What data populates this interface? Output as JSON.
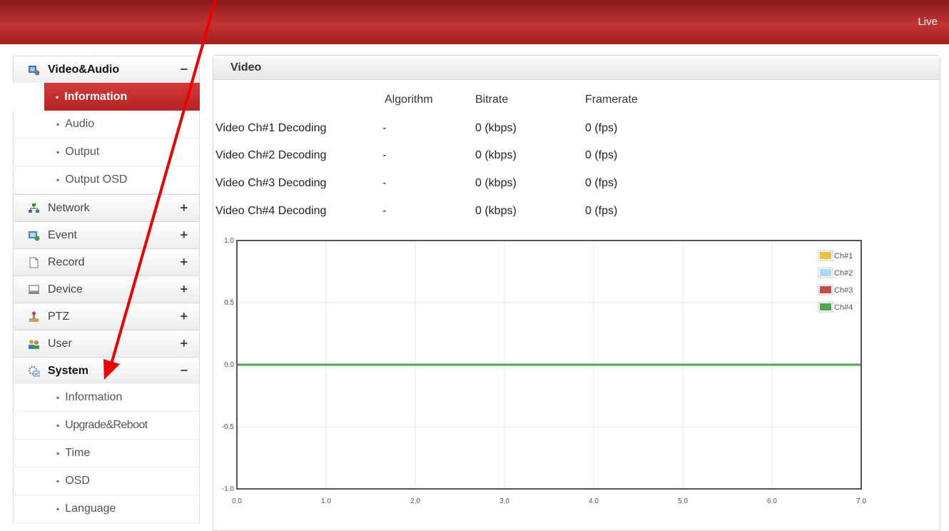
{
  "header": {
    "live_label": "Live"
  },
  "sidebar": {
    "groups": [
      {
        "label": "Video&Audio",
        "toggle": "−",
        "icon": "video-audio-icon",
        "items": [
          {
            "label": "Information"
          },
          {
            "label": "Audio"
          },
          {
            "label": "Output"
          },
          {
            "label": "Output OSD"
          }
        ]
      },
      {
        "label": "Network",
        "toggle": "+",
        "icon": "network-icon"
      },
      {
        "label": "Event",
        "toggle": "+",
        "icon": "event-icon"
      },
      {
        "label": "Record",
        "toggle": "+",
        "icon": "record-icon"
      },
      {
        "label": "Device",
        "toggle": "+",
        "icon": "device-icon"
      },
      {
        "label": "PTZ",
        "toggle": "+",
        "icon": "ptz-icon"
      },
      {
        "label": "User",
        "toggle": "+",
        "icon": "user-icon"
      },
      {
        "label": "System",
        "toggle": "−",
        "icon": "system-icon",
        "items": [
          {
            "label": "Information"
          },
          {
            "label": "Upgrade&Reboot"
          },
          {
            "label": "Time"
          },
          {
            "label": "OSD"
          },
          {
            "label": "Language"
          }
        ]
      }
    ],
    "bullet": "▪"
  },
  "panel": {
    "title": "Video",
    "columns": [
      "Algorithm",
      "Bitrate",
      "Framerate"
    ],
    "rows": [
      {
        "name": "Video Ch#1 Decoding",
        "algorithm": "-",
        "bitrate": "0 (kbps)",
        "framerate": "0 (fps)"
      },
      {
        "name": "Video Ch#2 Decoding",
        "algorithm": "-",
        "bitrate": "0 (kbps)",
        "framerate": "0 (fps)"
      },
      {
        "name": "Video Ch#3 Decoding",
        "algorithm": "-",
        "bitrate": "0 (kbps)",
        "framerate": "0 (fps)"
      },
      {
        "name": "Video Ch#4 Decoding",
        "algorithm": "-",
        "bitrate": "0 (kbps)",
        "framerate": "0 (fps)"
      }
    ]
  },
  "chart_data": {
    "type": "line",
    "x": [
      0,
      1,
      2,
      3,
      4,
      5,
      6,
      7
    ],
    "xticks": [
      "0.0",
      "1.0",
      "2.0",
      "3.0",
      "4.0",
      "5.0",
      "6.0",
      "7.0"
    ],
    "yticks": [
      "1.0",
      "0.5",
      "0.0",
      "-0.5",
      "-1.0"
    ],
    "xlim": [
      0,
      7
    ],
    "ylim": [
      -1,
      1
    ],
    "grid": true,
    "legend_position": "top-right",
    "series": [
      {
        "name": "Ch#1",
        "color": "#edc240",
        "values": [
          0,
          0,
          0,
          0,
          0,
          0,
          0,
          0
        ]
      },
      {
        "name": "Ch#2",
        "color": "#afd8f8",
        "values": [
          0,
          0,
          0,
          0,
          0,
          0,
          0,
          0
        ]
      },
      {
        "name": "Ch#3",
        "color": "#cb4b4b",
        "values": [
          0,
          0,
          0,
          0,
          0,
          0,
          0,
          0
        ]
      },
      {
        "name": "Ch#4",
        "color": "#4da74d",
        "values": [
          0,
          0,
          0,
          0,
          0,
          0,
          0,
          0
        ]
      }
    ]
  },
  "colors": {
    "topbar": "#b02a2a",
    "accent": "#c62f2f",
    "annotation_arrow": "#ee0000"
  }
}
